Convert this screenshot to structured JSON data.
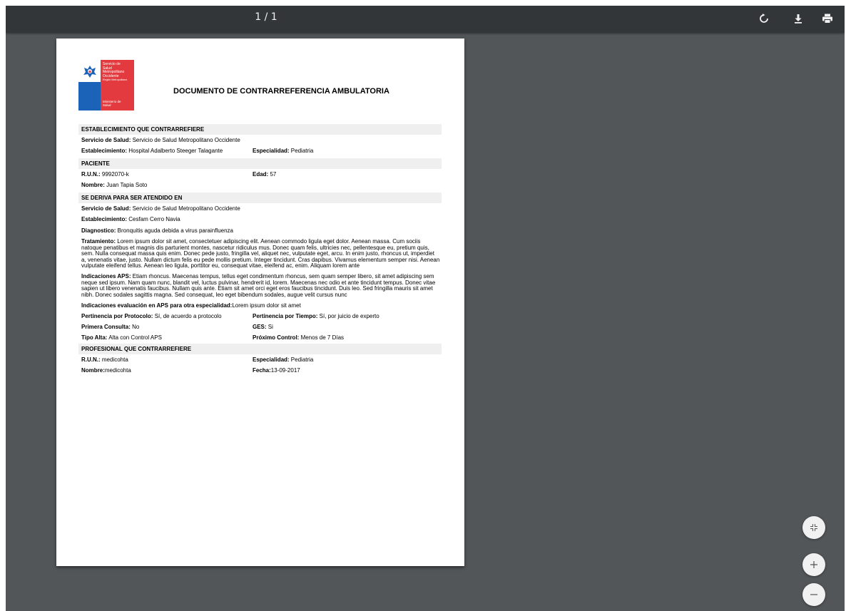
{
  "toolbar": {
    "page_indicator": "1 / 1",
    "rotate_icon": "rotate-icon",
    "download_icon": "download-icon",
    "print_icon": "print-icon"
  },
  "logo": {
    "line1": "Servicio de",
    "line2": "Salud",
    "line3": "Metropolitano",
    "line4": "Occidente",
    "region": "Región Metropolitana",
    "ministry1": "Ministerio de",
    "ministry2": "Salud"
  },
  "document": {
    "title": "DOCUMENTO DE CONTRARREFERENCIA AMBULATORIA",
    "sec1": {
      "header": "ESTABLECIMIENTO QUE CONTRARREFIERE",
      "servicio_label": "Servicio de Salud:",
      "servicio_value": " Servicio de Salud Metropolitano Occidente",
      "estab_label": "Establecimiento:",
      "estab_value": " Hospital Adalberto Steeger Talagante",
      "esp_label": "Especialidad:",
      "esp_value": " Pediatria"
    },
    "sec2": {
      "header": "PACIENTE",
      "run_label": "R.U.N.:",
      "run_value": " 9992070-k",
      "edad_label": "Edad:",
      "edad_value": " 57",
      "nombre_label": "Nombre:",
      "nombre_value": " Juan Tapia Soto"
    },
    "sec3": {
      "header": "SE DERIVA PARA SER ATENDIDO EN",
      "servicio_label": "Servicio de Salud:",
      "servicio_value": " Servicio de Salud Metropolitano Occidente",
      "estab_label": "Establecimiento:",
      "estab_value": " Cesfam Cerro Navia",
      "diag_label": "Diagnostico:",
      "diag_value": " Bronquitis aguda debida a virus parainfluenza",
      "trat_label": "Tratamiento:",
      "trat_value": " Lorem ipsum dolor sit amet, consectetuer adipiscing elit. Aenean commodo ligula eget dolor. Aenean massa. Cum sociis natoque penatibus et magnis dis parturient montes, nascetur ridiculus mus. Donec quam felis, ultricies nec, pellentesque eu, pretium quis, sem. Nulla consequat massa quis enim. Donec pede justo, fringilla vel, aliquet nec, vulputate eget, arcu. In enim justo, rhoncus ut, imperdiet a, venenatis vitae, justo. Nullam dictum felis eu pede mollis pretium. Integer tincidunt. Cras dapibus. Vivamus elementum semper nisi. Aenean vulputate eleifend tellus. Aenean leo ligula, porttitor eu, consequat vitae, eleifend ac, enim. Aliquam lorem ante",
      "aps_label": "Indicaciones APS:",
      "aps_value": " Etiam rhoncus. Maecenas tempus, tellus eget condimentum rhoncus, sem quam semper libero, sit amet adipiscing sem neque sed ipsum. Nam quam nunc, blandit vel, luctus pulvinar, hendrerit id, lorem. Maecenas nec odio et ante tincidunt tempus. Donec vitae sapien ut libero venenatis faucibus. Nullam quis ante. Etiam sit amet orci eget eros faucibus tincidunt. Duis leo. Sed fringilla mauris sit amet nibh. Donec sodales sagittis magna. Sed consequat, leo eget bibendum sodales, augue velit cursus nunc",
      "eval_label": "Indicaciones evaluación en APS para otra especialidad:",
      "eval_value": "Lorem ipsum dolor sit amet",
      "pprot_label": "Pertinencia por Protocolo:",
      "pprot_value": " Sí, de acuerdo a protocolo",
      "ptiempo_label": "Pertinencia por Tiempo:",
      "ptiempo_value": " Sí, por juicio de experto",
      "primera_label": "Primera Consulta:",
      "primera_value": " No",
      "ges_label": "GES:",
      "ges_value": " Si",
      "alta_label": "Tipo Alta:",
      "alta_value": " Alta con Control APS",
      "prox_label": "Próximo Control:",
      "prox_value": " Menos de 7 Días"
    },
    "sec4": {
      "header": "PROFESIONAL QUE CONTRARREFIERE",
      "run_label": "R.U.N.:",
      "run_value": " medicohta",
      "esp_label": "Especialidad:",
      "esp_value": " Pediatria",
      "nombre_label": "Nombre:",
      "nombre_value": "medicohta",
      "fecha_label": "Fecha:",
      "fecha_value": "13-09-2017"
    }
  },
  "controls": {
    "fit_icon": "fit-to-page-icon",
    "zoom_in_icon": "zoom-in-icon",
    "zoom_out_icon": "zoom-out-icon"
  },
  "colors": {
    "toolbar_bg": "#323639",
    "viewer_bg": "#525659",
    "logo_blue": "#1b63b8",
    "logo_red": "#e23a3e"
  }
}
